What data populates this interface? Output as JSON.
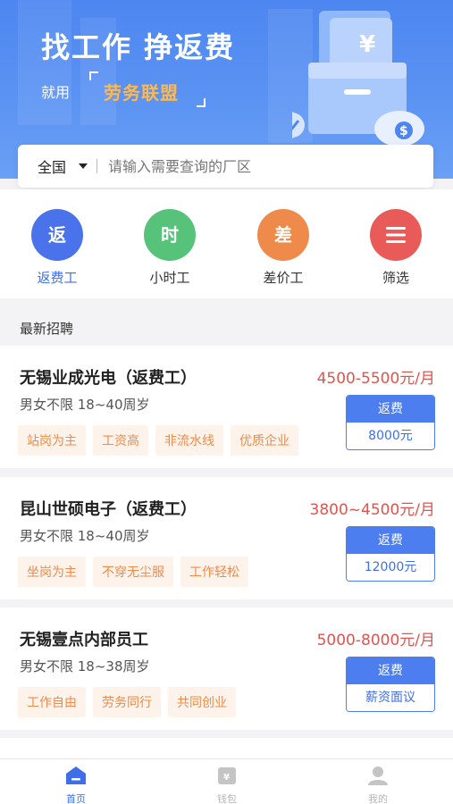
{
  "banner": {
    "slogan": "找工作 挣返费",
    "sub_prefix": "就用",
    "brand": "劳务联盟"
  },
  "search": {
    "region": "全国",
    "placeholder": "请输入需要查询的厂区"
  },
  "categories": [
    {
      "label": "返费工",
      "glyph": "返",
      "color": "#4a72ea",
      "active": true
    },
    {
      "label": "小时工",
      "glyph": "时",
      "color": "#57c27a",
      "active": false
    },
    {
      "label": "差价工",
      "glyph": "差",
      "color": "#ef8b4a",
      "active": false
    },
    {
      "label": "筛选",
      "glyph": "menu-icon",
      "color": "#e85b58",
      "active": false
    }
  ],
  "section_title": "最新招聘",
  "jobs": [
    {
      "title": "无锡业成光电（返费工）",
      "salary": "4500-5500元/月",
      "req": "男女不限 18~40周岁",
      "tags": [
        "站岗为主",
        "工资高",
        "非流水线",
        "优质企业"
      ],
      "fee_label": "返费",
      "fee_value": "8000元"
    },
    {
      "title": "昆山世硕电子（返费工）",
      "salary": "3800~4500元/月",
      "req": "男女不限 18~40周岁",
      "tags": [
        "坐岗为主",
        "不穿无尘服",
        "工作轻松"
      ],
      "fee_label": "返费",
      "fee_value": "12000元"
    },
    {
      "title": "无锡壹点内部员工",
      "salary": "5000-8000元/月",
      "req": "男女不限 18~38周岁",
      "tags": [
        "工作自由",
        "劳务同行",
        "共同创业"
      ],
      "fee_label": "返费",
      "fee_value": "薪资面议"
    }
  ],
  "tabbar": [
    {
      "label": "首页",
      "icon": "home-icon",
      "active": true
    },
    {
      "label": "钱包",
      "icon": "wallet-icon",
      "active": false
    },
    {
      "label": "我的",
      "icon": "profile-icon",
      "active": false
    }
  ],
  "colors": {
    "primary": "#4d7ef0",
    "salary": "#e0544f",
    "tag_text": "#ef8b4a",
    "tag_bg": "#fdf3ea"
  }
}
